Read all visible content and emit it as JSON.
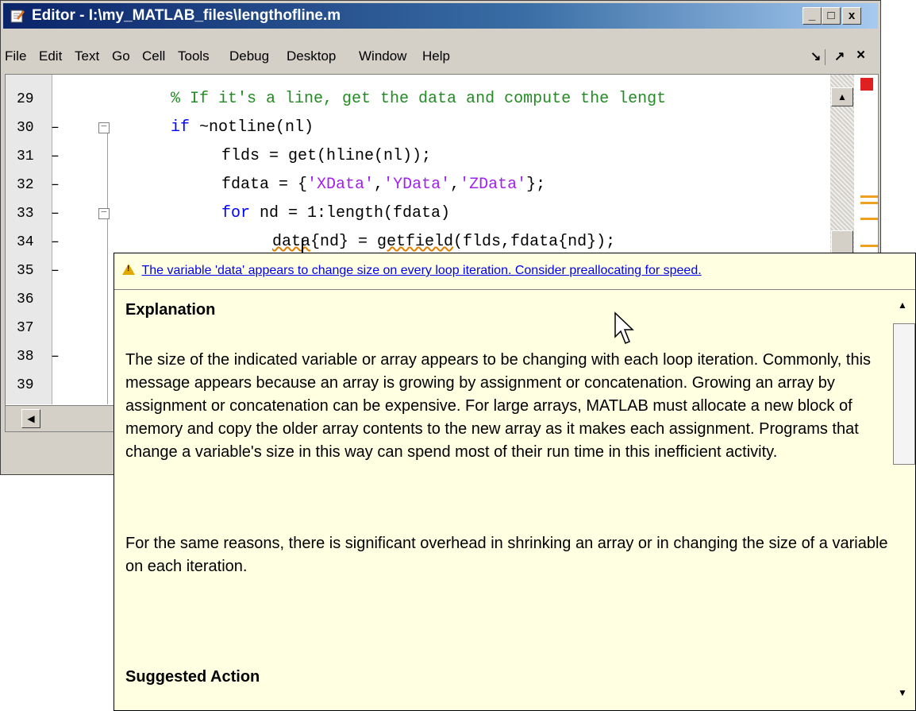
{
  "window": {
    "title": "Editor - I:\\my_MATLAB_files\\lengthofline.m",
    "min_glyph": "_",
    "max_glyph": "□",
    "close_glyph": "x"
  },
  "menu": {
    "items": [
      "File",
      "Edit",
      "Text",
      "Go",
      "Cell",
      "Tools",
      "Debug",
      "Desktop",
      "Window",
      "Help"
    ],
    "dock_glyph": "↘",
    "undock_glyph": "↗",
    "close_glyph": "×"
  },
  "code": {
    "lines": [
      {
        "num": "29",
        "dash": ""
      },
      {
        "num": "30",
        "dash": "–"
      },
      {
        "num": "31",
        "dash": "–"
      },
      {
        "num": "32",
        "dash": "–"
      },
      {
        "num": "33",
        "dash": "–"
      },
      {
        "num": "34",
        "dash": "–"
      },
      {
        "num": "35",
        "dash": "–"
      },
      {
        "num": "36",
        "dash": ""
      },
      {
        "num": "37",
        "dash": ""
      },
      {
        "num": "38",
        "dash": "–"
      },
      {
        "num": "39",
        "dash": ""
      }
    ],
    "l29_comment": "% If it's a line, get the data and compute the lengt",
    "l30_kw": "if",
    "l30_rest": " ~notline(nl)",
    "l31": "flds = get(hline(nl));",
    "l32_a": "fdata = {",
    "l32_s1": "'XData'",
    "l32_c1": ",",
    "l32_s2": "'YData'",
    "l32_c2": ",",
    "l32_s3": "'ZData'",
    "l32_b": "};",
    "l33_kw": "for",
    "l33_rest": " nd = 1:length(fdata)",
    "l34_a": "data",
    "l34_b": "{nd} = ",
    "l34_c": "getfield",
    "l34_d": "(flds,fdata{nd});"
  },
  "tooltip": {
    "message": "The variable 'data' appears to change size on every loop iteration. Consider preallocating for speed.",
    "explanation_heading": "Explanation",
    "paragraph1": "The size of the indicated variable or array appears to be changing with each loop iteration. Commonly, this message appears because an array is growing by assignment or concatenation. Growing an array by assignment or concatenation can be expensive. For large arrays, MATLAB must allocate a new block of memory and copy the older array contents to the new array as it makes each assignment. Programs that change a variable's size in this way can spend most of their run time in this inefficient activity.",
    "paragraph2": "For the same reasons, there is significant overhead in shrinking an array or in changing the size of a variable on each iteration.",
    "suggested_heading": "Suggested Action"
  },
  "colors": {
    "keyword": "#0000ff",
    "comment": "#228b22",
    "string": "#a020f0",
    "tooltip_bg": "#ffffe1",
    "link": "#0000ee",
    "warning_marker": "#f0a020",
    "error_status": "#e02020"
  },
  "icons": [
    "editor-app-icon",
    "warning-icon",
    "fold-collapse-icon",
    "mouse-pointer-icon"
  ]
}
